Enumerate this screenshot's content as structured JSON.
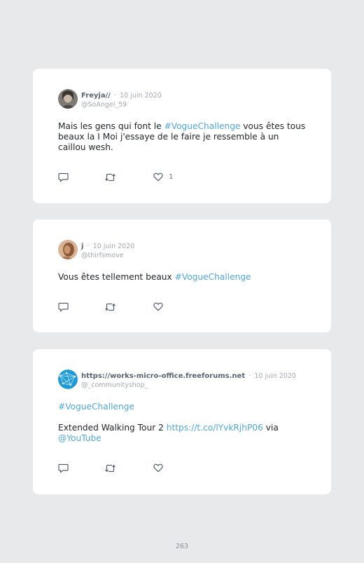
{
  "tweets": [
    {
      "name": "Freyja//",
      "date": "10 juin 2020",
      "handle": "@SoAngel_59",
      "text_before": "Mais les gens qui font le ",
      "hashtag": "#VogueChallenge",
      "text_after": " vous êtes tous beaux la I Moi j'essaye de le faire je ressemble à un caillou wesh.",
      "likes": "1"
    },
    {
      "name": "j",
      "date": "10 juin 2020",
      "handle": "@thirfsmove",
      "text_before": "Vous êtes tellement beaux ",
      "hashtag": "#VogueChallenge"
    },
    {
      "name": "https://works-micro-office.freeforums.net",
      "date": "10 juin 2020",
      "handle": "@_communityshop_",
      "hashtag": "#VogueChallenge",
      "line2_before": "Extended Walking Tour 2 ",
      "url": "https://t.co/lYvkRjhP06",
      "line2_mid": " via",
      "mention": "@YouTube"
    }
  ],
  "separator": "·",
  "page_number": "263"
}
